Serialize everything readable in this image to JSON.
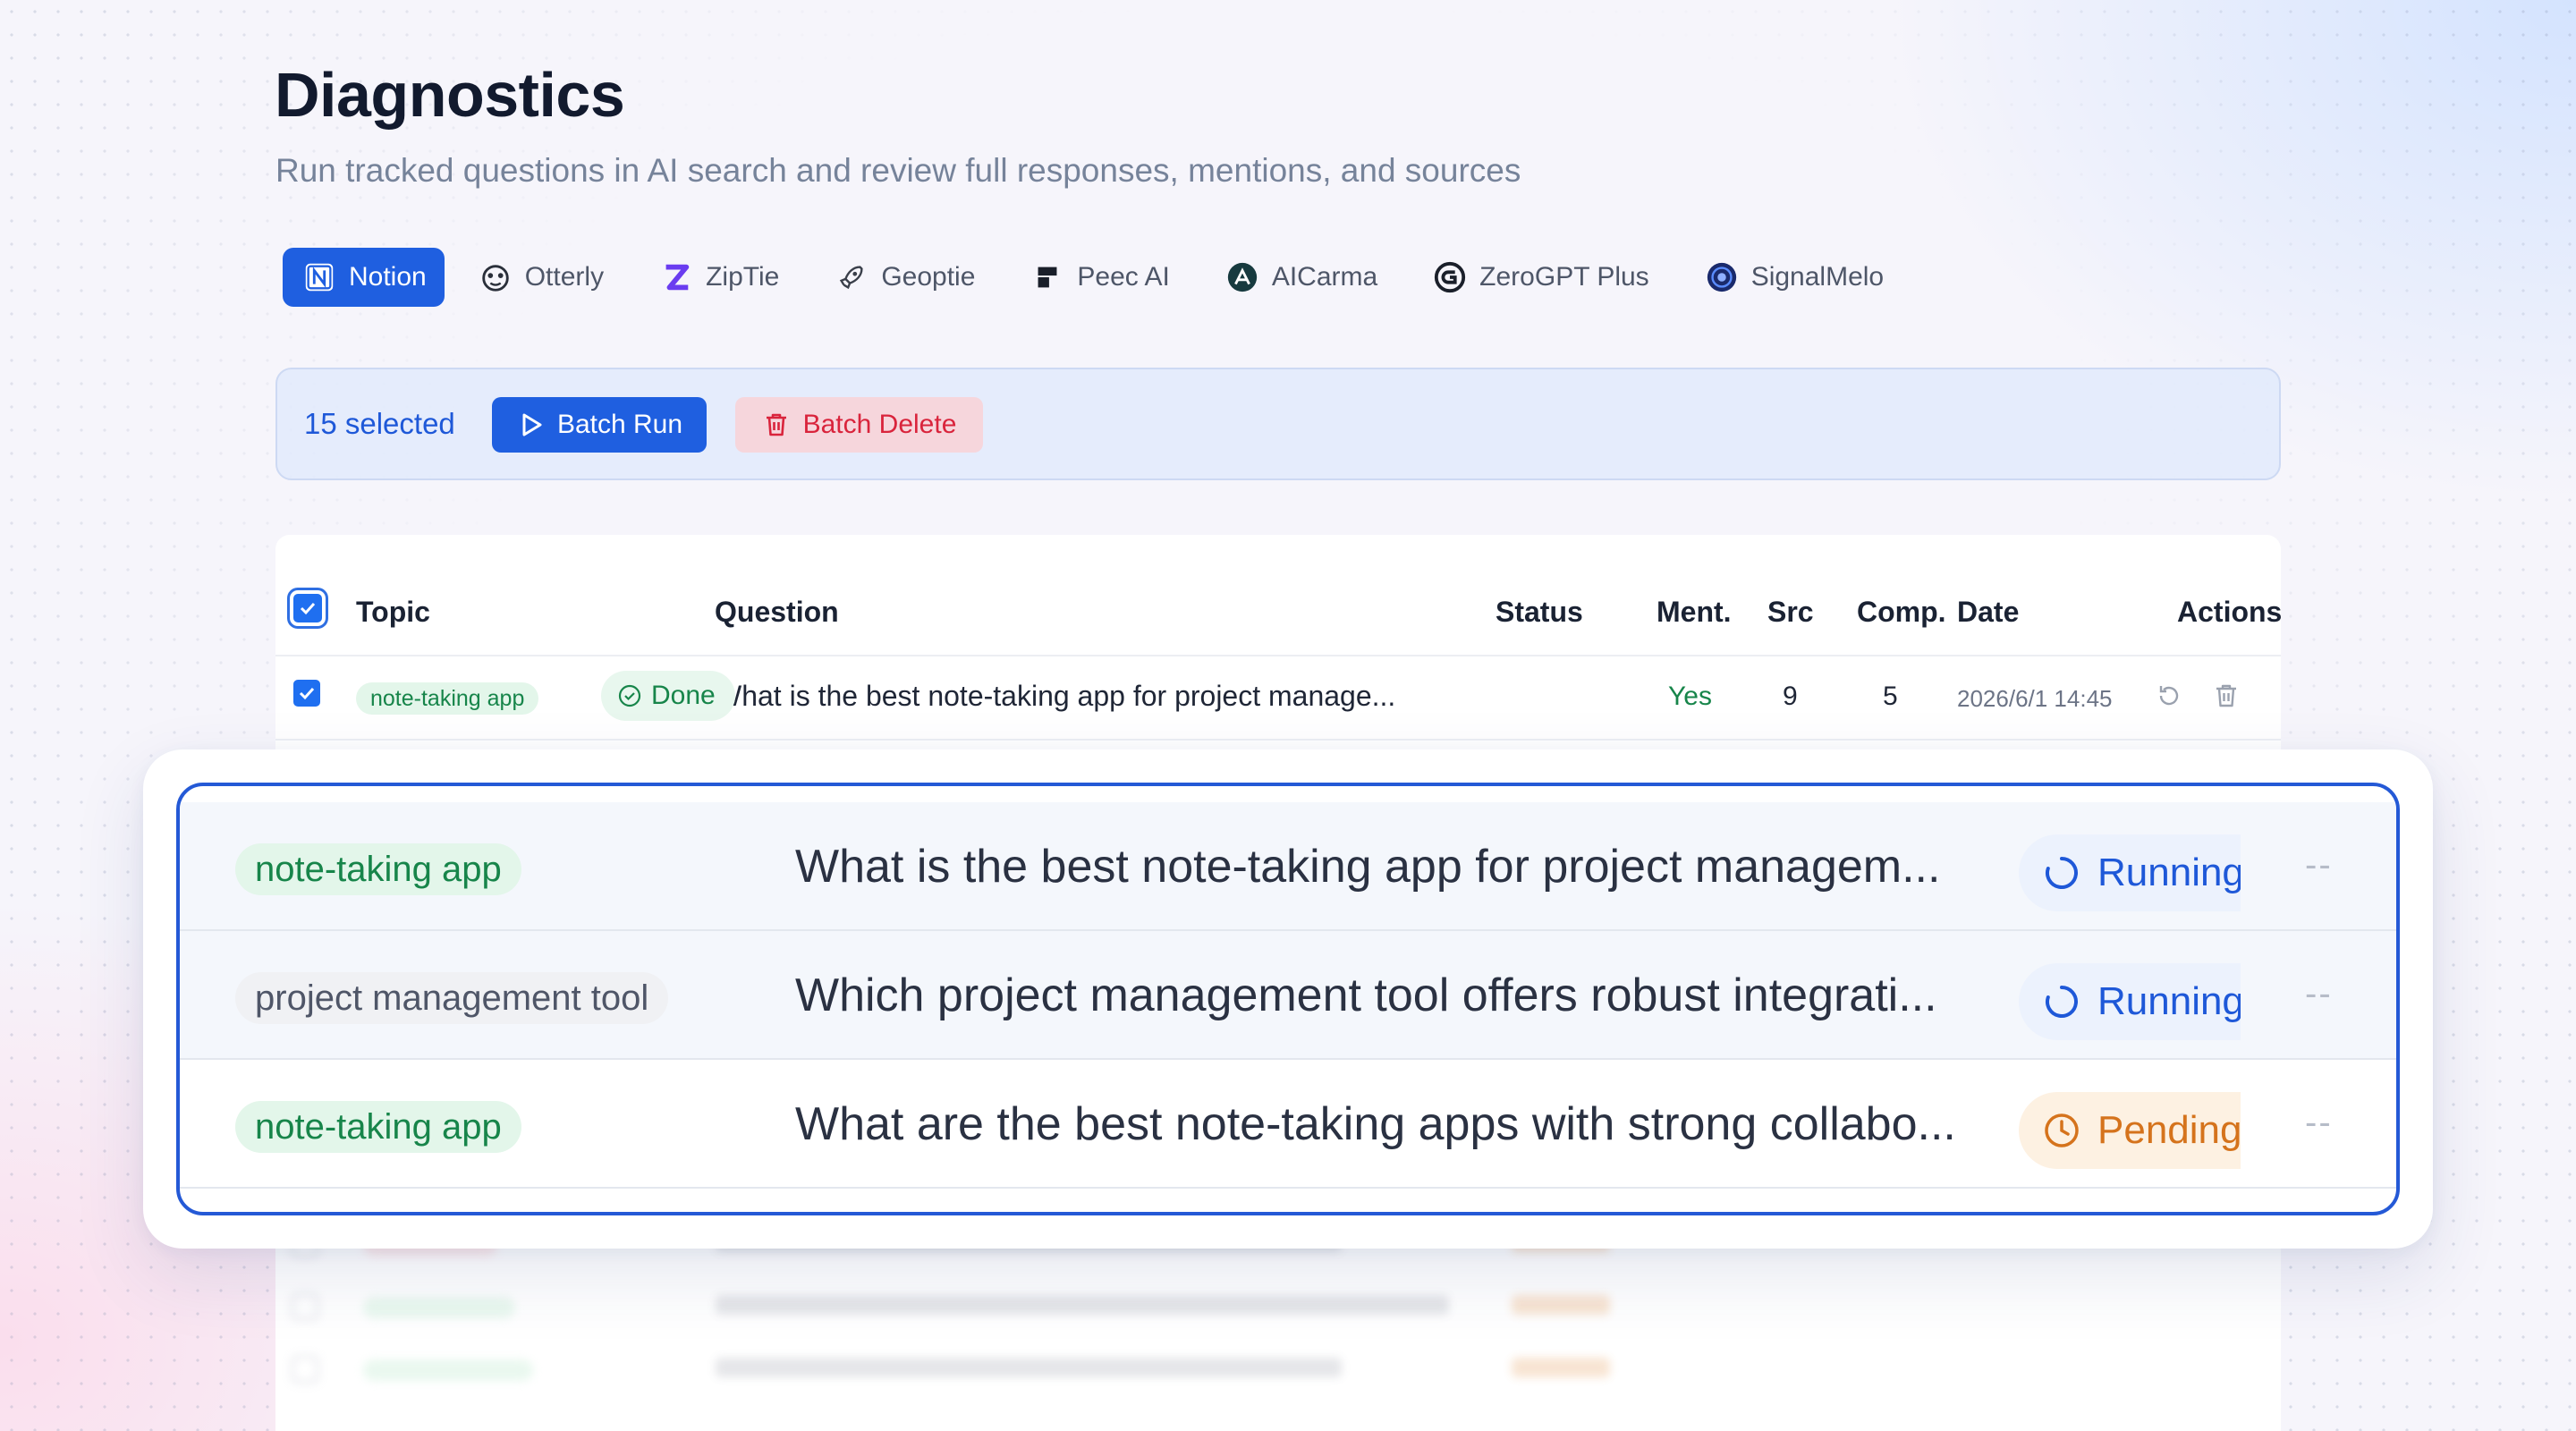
{
  "page": {
    "title": "Diagnostics",
    "subtitle": "Run tracked questions in AI search and review full responses, mentions, and sources"
  },
  "tabs": [
    {
      "label": "Notion",
      "icon": "notion-icon",
      "active": true
    },
    {
      "label": "Otterly",
      "icon": "otterly-icon"
    },
    {
      "label": "ZipTie",
      "icon": "ziptie-icon"
    },
    {
      "label": "Geoptie",
      "icon": "rocket-icon"
    },
    {
      "label": "Peec AI",
      "icon": "peec-icon"
    },
    {
      "label": "AICarma",
      "icon": "aicarma-icon"
    },
    {
      "label": "ZeroGPT Plus",
      "icon": "zerogpt-icon"
    },
    {
      "label": "SignalMelo",
      "icon": "signalmelo-icon"
    }
  ],
  "batch": {
    "selected": "15 selected",
    "run_label": "Batch Run",
    "delete_label": "Batch Delete"
  },
  "table": {
    "columns": [
      "Topic",
      "Question",
      "Status",
      "Ment.",
      "Src",
      "Comp.",
      "Date",
      "Actions"
    ],
    "first_row": {
      "topic": "note-taking app",
      "question": "What is the best note-taking app for project manage...",
      "status": "Done",
      "mentioned": "Yes",
      "src": "9",
      "comp": "5",
      "date": "2026/6/1 14:45"
    }
  },
  "overlay_rows": [
    {
      "topic": "note-taking app",
      "topic_style": "green",
      "question": "What is the best note-taking app for project managem...",
      "status": "Running",
      "status_type": "running",
      "extra": "--"
    },
    {
      "topic": "project management tool",
      "topic_style": "gray",
      "question": "Which project management tool offers robust integrati...",
      "status": "Running",
      "status_type": "running",
      "extra": "--"
    },
    {
      "topic": "note-taking app",
      "topic_style": "green",
      "question": "What are the best note-taking apps with strong collabo...",
      "status": "Pending",
      "status_type": "pending",
      "extra": "--"
    }
  ],
  "colors": {
    "primary": "#1f5fe0",
    "danger": "#d9243c",
    "success": "#17854a",
    "pending": "#d5731c"
  }
}
